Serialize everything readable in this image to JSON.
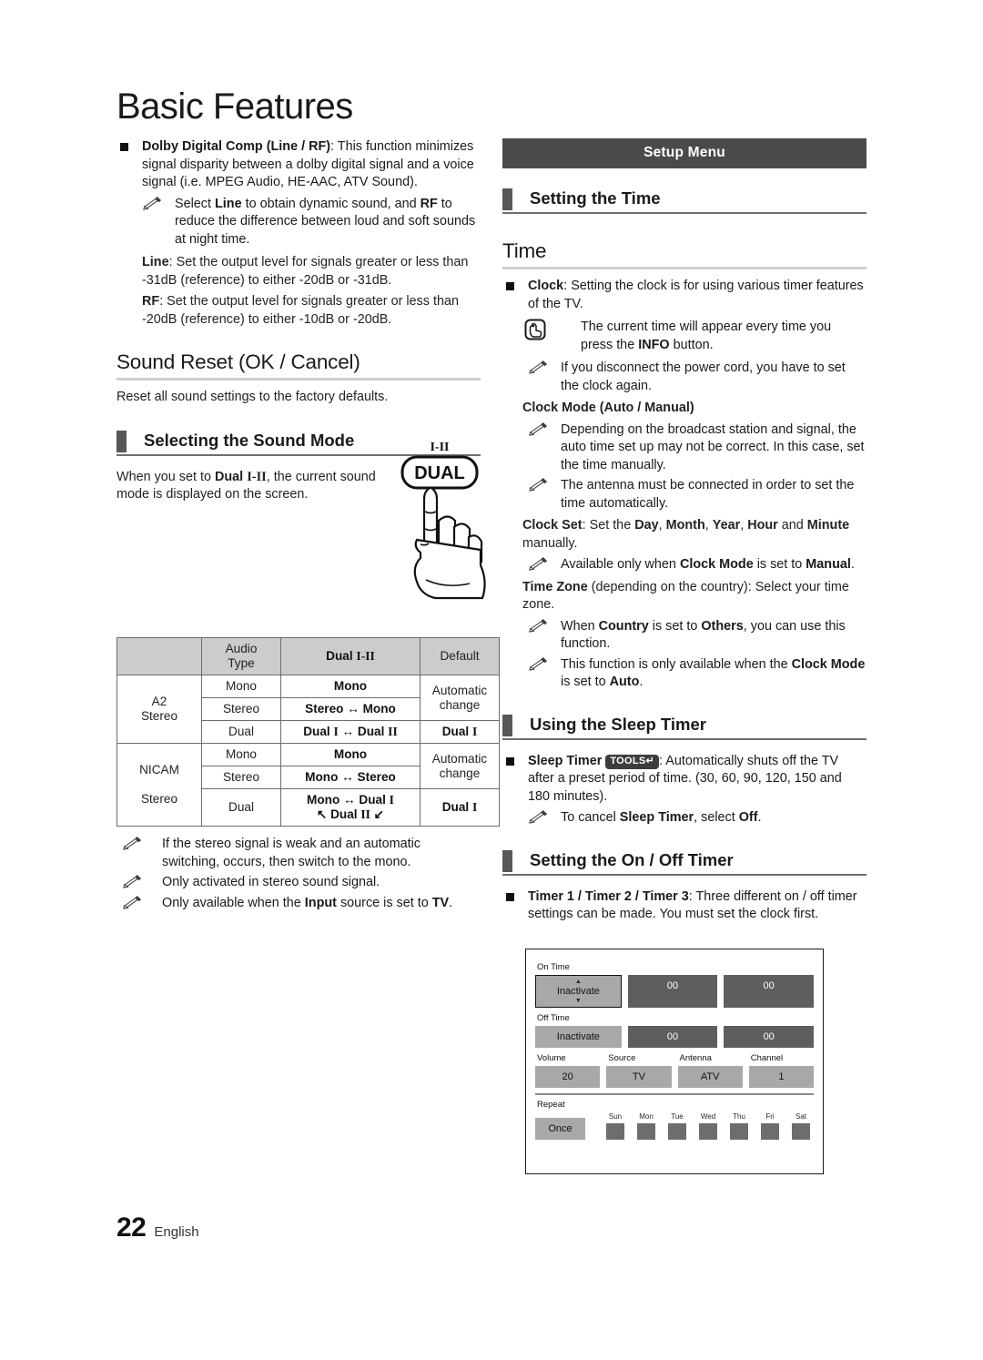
{
  "document": {
    "title": "Basic Features",
    "footer": {
      "page_number": "22",
      "language": "English"
    }
  },
  "left_column": {
    "dolby_item": {
      "bold_lead": "Dolby Digital Comp (Line / RF)",
      "text": ": This function minimizes signal disparity between a dolby digital signal and a voice signal (i.e. MPEG Audio, HE-AAC, ATV Sound)."
    },
    "dolby_note": {
      "p1": "Select ",
      "b1": "Line",
      "p2": " to obtain dynamic sound, and ",
      "b2": "RF",
      "p3": " to reduce the difference between loud and soft sounds at night time."
    },
    "line_para": {
      "bold_lead": "Line",
      "text": ": Set the output level for signals greater or less than -31dB (reference) to either -20dB or -31dB."
    },
    "rf_para": {
      "bold_lead": "RF",
      "text": ": Set the output level for signals greater or less than -20dB (reference) to either -10dB or -20dB."
    },
    "sound_reset_heading": "Sound Reset (OK / Cancel)",
    "sound_reset_body": "Reset all sound settings to the factory defaults.",
    "selecting_sound_mode_heading": "Selecting the Sound Mode",
    "sound_mode_body": {
      "p1": "When you set to ",
      "b1": "Dual",
      "b1b": "I-II",
      "p2": ", the current sound mode is displayed on the screen."
    },
    "illustration": {
      "button_label": "DUAL",
      "top_label": "I-II"
    },
    "table": {
      "headers": [
        "",
        "Audio Type",
        "Dual I-II",
        "Default"
      ],
      "groups": [
        {
          "name": "A2 Stereo",
          "rows": [
            {
              "audio_type": "Mono",
              "dual": "Mono",
              "default": "Automatic change"
            },
            {
              "audio_type": "Stereo",
              "dual": "Stereo ↔ Mono",
              "default": ""
            },
            {
              "audio_type": "Dual",
              "dual": "Dual I ↔ Dual II",
              "default": "Dual I"
            }
          ]
        },
        {
          "name": "NICAM Stereo",
          "rows": [
            {
              "audio_type": "Mono",
              "dual": "Mono",
              "default": "Automatic change"
            },
            {
              "audio_type": "Stereo",
              "dual": "Mono ↔ Stereo",
              "default": ""
            },
            {
              "audio_type": "Dual",
              "dual": "Mono ↔ Dual I",
              "dual2": "↖ Dual II ↙",
              "default": "Dual I"
            }
          ]
        }
      ]
    },
    "notes": [
      "If the stereo signal is weak and an automatic switching, occurs, then switch to the mono.",
      "Only activated in stereo sound signal."
    ],
    "note_input": {
      "p1": "Only available when the ",
      "b1": "Input",
      "p2": " source is set to ",
      "b2": "TV",
      "p3": "."
    }
  },
  "right_column": {
    "banner": "Setup Menu",
    "setting_time_heading": "Setting the Time",
    "time_heading": "Time",
    "clock_item": {
      "bold_lead": "Clock",
      "text": ": Setting the clock is for using various timer features of the TV."
    },
    "info_note": {
      "p1": "The current time will appear every time you press the ",
      "b1": "INFO",
      "p2": " button."
    },
    "power_cord_note": "If you disconnect the power cord, you have to set the clock again.",
    "clock_mode_heading": "Clock Mode (Auto / Manual)",
    "clock_mode_note_1": "Depending on the broadcast station and signal, the auto time set up may not be correct. In this case, set the time manually.",
    "clock_mode_note_2": "The antenna must be connected in order to set the time automatically.",
    "clock_set": {
      "bold_lead": "Clock Set",
      "p1": ": Set the ",
      "b1": "Day",
      "p2": ", ",
      "b2": "Month",
      "p3": ", ",
      "b3": "Year",
      "p4": ", ",
      "b4": "Hour",
      "p5": " and ",
      "b5": "Minute",
      "p6": " manually."
    },
    "clock_set_note": {
      "p1": "Available only when ",
      "b1": "Clock Mode",
      "p2": " is set to ",
      "b2": "Manual",
      "p3": "."
    },
    "time_zone": {
      "bold_lead": "Time Zone",
      "text": " (depending on the country): Select your time zone."
    },
    "time_zone_note_1": {
      "p1": "When ",
      "b1": "Country",
      "p2": " is set to ",
      "b2": "Others",
      "p3": ", you can use this function."
    },
    "time_zone_note_2": {
      "p1": "This function is only available when the ",
      "b1": "Clock Mode",
      "p2": " is set to ",
      "b2": "Auto",
      "p3": "."
    },
    "sleep_timer_heading": "Using the Sleep Timer",
    "sleep_timer_item": {
      "bold_lead": "Sleep Timer",
      "badge": "TOOLS",
      "text": ": Automatically shuts off the TV after a preset period of time. (30, 60, 90, 120, 150 and 180 minutes)."
    },
    "sleep_timer_note": {
      "p1": "To cancel ",
      "b1": "Sleep Timer",
      "p2": ", select ",
      "b2": "Off",
      "p3": "."
    },
    "onoff_timer_heading": "Setting the On / Off Timer",
    "timer_item": {
      "bold_lead": "Timer 1 / Timer 2 / Timer 3",
      "text": ": Three different on / off timer settings can be made. You must set the clock first."
    },
    "timer_mockup": {
      "on_time_label": "On Time",
      "on_time_mode": "Inactivate",
      "on_time_hour": "00",
      "on_time_minute": "00",
      "off_time_label": "Off Time",
      "off_time_mode": "Inactivate",
      "off_time_hour": "00",
      "off_time_minute": "00",
      "volume_label": "Volume",
      "volume_value": "20",
      "source_label": "Source",
      "source_value": "TV",
      "antenna_label": "Antenna",
      "antenna_value": "ATV",
      "channel_label": "Channel",
      "channel_value": "1",
      "repeat_label": "Repeat",
      "repeat_value": "Once",
      "days": [
        "Sun",
        "Mon",
        "Tue",
        "Wed",
        "Thu",
        "Fri",
        "Sat"
      ]
    }
  },
  "colors": {
    "banner_bg": "#4a4a4a",
    "tab_marker": "#585858",
    "table_header_bg": "#cccccc",
    "field_light": "#a8a8a8",
    "field_dark": "#5e5e5e"
  }
}
